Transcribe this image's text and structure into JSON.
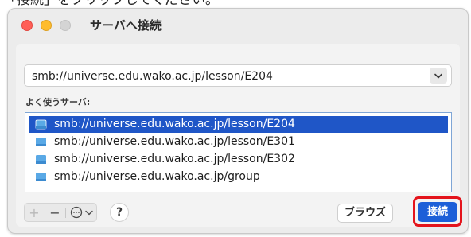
{
  "instruction": {
    "cropped_text": "「接続」をクリックしてください。"
  },
  "window": {
    "title": "サーバへ接続",
    "server_address": {
      "value": "smb://universe.edu.wako.ac.jp/lesson/E204"
    },
    "favorites_label": "よく使うサーバ:",
    "favorites": [
      {
        "label": "smb://universe.edu.wako.ac.jp/lesson/E204",
        "selected": true
      },
      {
        "label": "smb://universe.edu.wako.ac.jp/lesson/E301",
        "selected": false
      },
      {
        "label": "smb://universe.edu.wako.ac.jp/lesson/E302",
        "selected": false
      },
      {
        "label": "smb://universe.edu.wako.ac.jp/group",
        "selected": false
      }
    ],
    "toolbar": {
      "add_label": "+",
      "remove_label": "−",
      "help_label": "?"
    },
    "browse_label": "ブラウズ",
    "connect_label": "接続"
  },
  "colors": {
    "selection": "#1f56c7",
    "connect_button": "#1d5fd8",
    "highlight": "#e4141c",
    "close_light": "#ff5f57",
    "minimize_light": "#febc2e"
  },
  "icons": {
    "url_dropdown": "chevron-down-icon",
    "server_item": "server-share-icon",
    "more_options": "ellipsis-circle-icon"
  }
}
